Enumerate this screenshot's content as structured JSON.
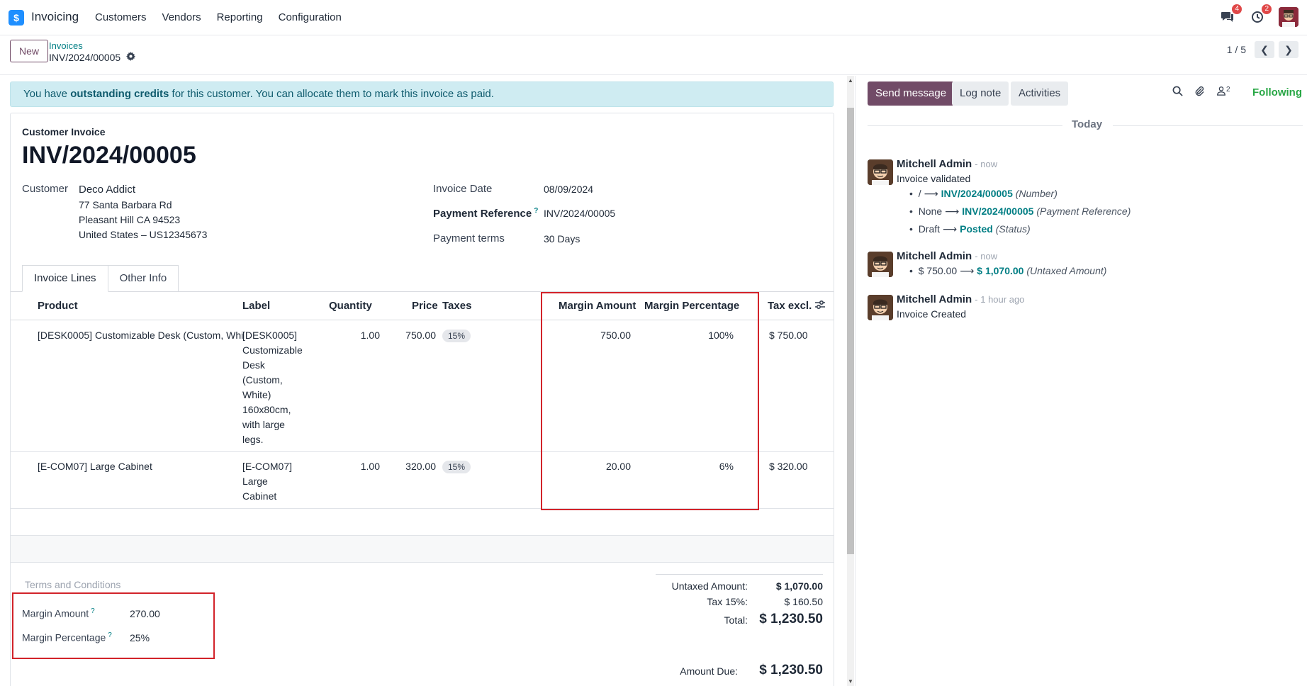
{
  "topbar": {
    "app_name": "Invoicing",
    "menu": [
      "Customers",
      "Vendors",
      "Reporting",
      "Configuration"
    ],
    "messages_badge": "4",
    "activities_badge": "2"
  },
  "control": {
    "new_label": "New",
    "breadcrumb_parent": "Invoices",
    "breadcrumb_current": "INV/2024/00005",
    "pager": "1 / 5"
  },
  "alert": {
    "prefix": "You have ",
    "bold": "outstanding credits",
    "suffix": " for this customer. You can allocate them to mark this invoice as paid."
  },
  "invoice": {
    "type": "Customer Invoice",
    "name": "INV/2024/00005",
    "customer_label": "Customer",
    "customer": "Deco Addict",
    "address1": "77 Santa Barbara Rd",
    "address2": "Pleasant Hill CA 94523",
    "address3": "United States – US12345673",
    "date_label": "Invoice Date",
    "date": "08/09/2024",
    "payref_label": "Payment Reference",
    "payref": "INV/2024/00005",
    "terms_label": "Payment terms",
    "terms": "30 Days"
  },
  "tabs": [
    "Invoice Lines",
    "Other Info"
  ],
  "table": {
    "headers": {
      "product": "Product",
      "label": "Label",
      "quantity": "Quantity",
      "price": "Price",
      "taxes": "Taxes",
      "margin_amount": "Margin Amount",
      "margin_pct": "Margin Percentage",
      "tax_excl": "Tax excl."
    },
    "rows": [
      {
        "product": "[DESK0005] Customizable Desk (Custom, Whi",
        "label_lines": [
          "[DESK0005]",
          "Customizable",
          "Desk",
          "(Custom,",
          "White)",
          "160x80cm,",
          "with large",
          "legs."
        ],
        "quantity": "1.00",
        "price": "750.00",
        "tax": "15%",
        "margin_amount": "750.00",
        "margin_pct": "100%",
        "tax_excl": "$ 750.00"
      },
      {
        "product": "[E-COM07] Large Cabinet",
        "label_lines": [
          "[E-COM07]",
          "Large",
          "Cabinet"
        ],
        "quantity": "1.00",
        "price": "320.00",
        "tax": "15%",
        "margin_amount": "20.00",
        "margin_pct": "6%",
        "tax_excl": "$ 320.00"
      }
    ]
  },
  "footer": {
    "terms_placeholder": "Terms and Conditions",
    "margin_amount_label": "Margin Amount",
    "margin_amount": "270.00",
    "margin_pct_label": "Margin Percentage",
    "margin_pct": "25%",
    "untaxed_label": "Untaxed Amount:",
    "untaxed": "$ 1,070.00",
    "tax_label": "Tax 15%:",
    "tax": "$ 160.50",
    "total_label": "Total:",
    "total": "$ 1,230.50",
    "due_label": "Amount Due:",
    "due": "$ 1,230.50"
  },
  "chatter": {
    "send_message": "Send message",
    "log_note": "Log note",
    "activities": "Activities",
    "followers_count": "2",
    "following": "Following",
    "today": "Today",
    "messages": [
      {
        "author": "Mitchell Admin",
        "time": "- now",
        "body": "Invoice validated",
        "tracking": [
          {
            "old": "/",
            "new": "INV/2024/00005",
            "field": "(Number)"
          },
          {
            "old": "None",
            "new": "INV/2024/00005",
            "field": "(Payment Reference)"
          },
          {
            "old": "Draft",
            "new": "Posted",
            "field": "(Status)"
          }
        ]
      },
      {
        "author": "Mitchell Admin",
        "time": "- now",
        "body": "",
        "tracking": [
          {
            "old": "$ 750.00",
            "new": "$ 1,070.00",
            "field": "(Untaxed Amount)"
          }
        ]
      },
      {
        "author": "Mitchell Admin",
        "time": "- 1 hour ago",
        "body": "Invoice Created",
        "tracking": []
      }
    ]
  },
  "colors": {
    "accent": "#714b67",
    "link": "#017e84",
    "highlight": "#d2232a",
    "alert_bg": "#cfecf2"
  }
}
